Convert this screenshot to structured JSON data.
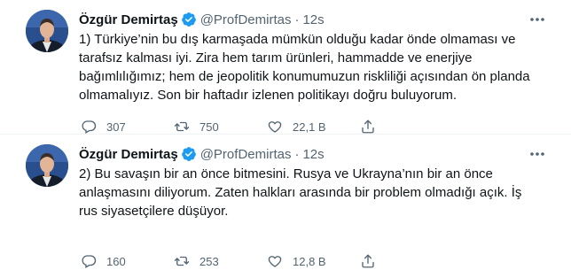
{
  "tweets": [
    {
      "author": {
        "name": "Özgür Demirtaş",
        "handle": "@ProfDemirtas",
        "verified": true
      },
      "separator": "·",
      "time": "12s",
      "text": "1) Türkiye’nin bu dış karmaşada mümkün olduğu kadar önde olmaması ve\ntarafsız kalması iyi. Zira hem tarım ürünleri, hammadde ve enerjiye\nbağımlılığımız; hem de jeopolitik konumumuzun riskliliği açısından ön planda\nolmamalıyız. Son bir haftadır izlenen politikayı doğru buluyorum.",
      "stats": {
        "replies": "307",
        "retweets": "750",
        "likes": "22,1 B"
      }
    },
    {
      "author": {
        "name": "Özgür Demirtaş",
        "handle": "@ProfDemirtas",
        "verified": true
      },
      "separator": "·",
      "time": "12s",
      "text": "2) Bu savaşın bir an önce bitmesini. Rusya ve Ukrayna’nın bir an önce\nanlaşmasını diliyorum. Zaten halkları arasında bir problem olmadığı açık. İş\nrus siyasetçilere düşüyor.",
      "stats": {
        "replies": "160",
        "retweets": "253",
        "likes": "12,8 B"
      }
    }
  ],
  "icons": {
    "verified": "verified-badge-icon",
    "more": "more-horizontal-icon",
    "reply": "reply-icon",
    "retweet": "retweet-icon",
    "like": "heart-icon",
    "share": "share-icon"
  },
  "colors": {
    "text": "#0f1419",
    "secondary": "#536471",
    "verified": "#1d9bf0",
    "divider": "#eff3f4"
  }
}
